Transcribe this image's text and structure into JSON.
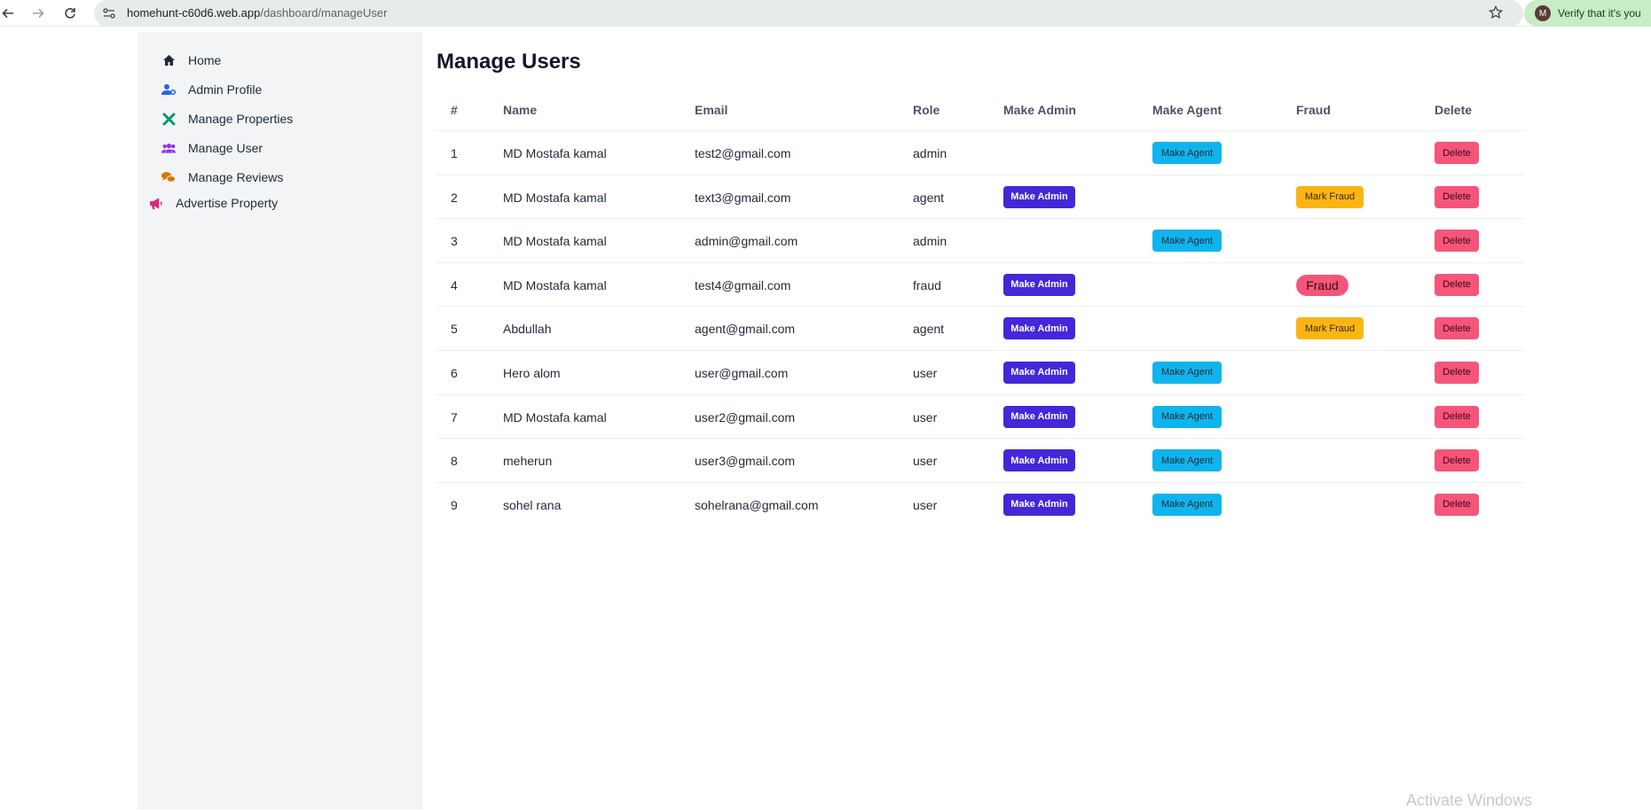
{
  "browser": {
    "url_host": "homehunt-c60d6.web.app",
    "url_path": "/dashboard/manageUser",
    "verify_text": "Verify that it's you",
    "avatar_letter": "M"
  },
  "sidebar": {
    "items": [
      {
        "label": "Home",
        "icon": "home-icon",
        "color": "#1f2937"
      },
      {
        "label": "Admin Profile",
        "icon": "user-cog-icon",
        "color": "#2563eb"
      },
      {
        "label": "Manage Properties",
        "icon": "tools-icon",
        "color": "#059669"
      },
      {
        "label": "Manage User",
        "icon": "users-icon",
        "color": "#9333ea"
      },
      {
        "label": "Manage Reviews",
        "icon": "comments-icon",
        "color": "#d97706"
      },
      {
        "label": "Advertise Property",
        "icon": "megaphone-icon",
        "color": "#db2777"
      }
    ]
  },
  "main": {
    "title": "Manage Users",
    "columns": [
      "#",
      "Name",
      "Email",
      "Role",
      "Make Admin",
      "Make Agent",
      "Fraud",
      "Delete"
    ],
    "labels": {
      "make_admin": "Make Admin",
      "make_agent": "Make Agent",
      "mark_fraud": "Mark Fraud",
      "fraud_badge": "Fraud",
      "delete": "Delete"
    },
    "rows": [
      {
        "num": "1",
        "name": "MD Mostafa kamal",
        "email": "test2@gmail.com",
        "role": "admin",
        "admin": false,
        "agent": true,
        "fraud": "none"
      },
      {
        "num": "2",
        "name": "MD Mostafa kamal",
        "email": "text3@gmail.com",
        "role": "agent",
        "admin": true,
        "agent": false,
        "fraud": "mark"
      },
      {
        "num": "3",
        "name": "MD Mostafa kamal",
        "email": "admin@gmail.com",
        "role": "admin",
        "admin": false,
        "agent": true,
        "fraud": "none"
      },
      {
        "num": "4",
        "name": "MD Mostafa kamal",
        "email": "test4@gmail.com",
        "role": "fraud",
        "admin": true,
        "agent": false,
        "fraud": "badge"
      },
      {
        "num": "5",
        "name": "Abdullah",
        "email": "agent@gmail.com",
        "role": "agent",
        "admin": true,
        "agent": false,
        "fraud": "mark"
      },
      {
        "num": "6",
        "name": "Hero alom",
        "email": "user@gmail.com",
        "role": "user",
        "admin": true,
        "agent": true,
        "fraud": "none"
      },
      {
        "num": "7",
        "name": "MD Mostafa kamal",
        "email": "user2@gmail.com",
        "role": "user",
        "admin": true,
        "agent": true,
        "fraud": "none"
      },
      {
        "num": "8",
        "name": "meherun",
        "email": "user3@gmail.com",
        "role": "user",
        "admin": true,
        "agent": true,
        "fraud": "none"
      },
      {
        "num": "9",
        "name": "sohel rana",
        "email": "sohelrana@gmail.com",
        "role": "user",
        "admin": true,
        "agent": true,
        "fraud": "none"
      }
    ]
  },
  "watermark": "Activate Windows"
}
